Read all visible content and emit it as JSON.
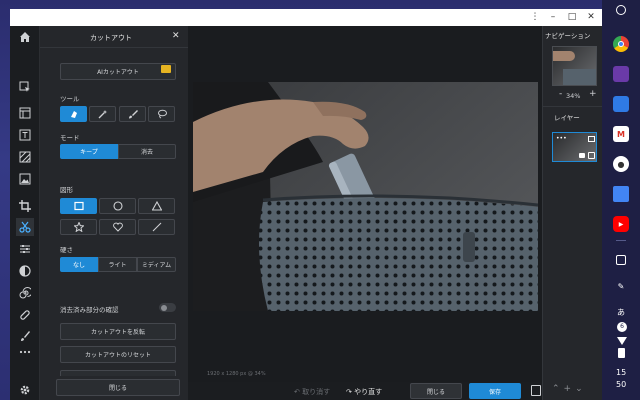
{
  "window": {
    "controls": [
      "⋮",
      "–",
      "□",
      "✕"
    ]
  },
  "left_rail": {
    "tools": [
      "home-icon",
      "pointer-icon",
      "layers-icon",
      "text-icon",
      "pattern-icon",
      "image-icon",
      "crop-icon",
      "cutout-icon",
      "adjust-icon",
      "filter-icon",
      "spiral-icon",
      "bandage-icon",
      "brush-icon",
      "more-icon"
    ],
    "settings_icon": "gear-icon"
  },
  "cutout_panel": {
    "title": "カットアウト",
    "close": "✕",
    "ai_cutout_label": "AIカットアウト",
    "tools_label": "ツール",
    "mode_label": "モード",
    "mode_keep": "キープ",
    "mode_erase": "消去",
    "shapes_label": "図形",
    "hardness_label": "硬さ",
    "hardness_none": "なし",
    "hardness_light": "ライト",
    "hardness_medium": "ミディアム",
    "confirm_erased_label": "消去済み部分の確認",
    "invert_label": "カットアウトを反転",
    "reset_label": "カットアウトのリセット",
    "close_button": "閉じる"
  },
  "canvas": {
    "status": "1920 x 1280 px @ 34%",
    "undo_label": "取り消す",
    "redo_label": "やり直す",
    "close_label": "閉じる",
    "save_label": "保存"
  },
  "right_panel": {
    "navigation_title": "ナビゲーション",
    "zoom_minus": "-",
    "zoom_value": "34%",
    "zoom_plus": "+",
    "layers_title": "レイヤー",
    "layer_more": "•••"
  },
  "shelf": {
    "time_hour": "15",
    "time_min": "50",
    "ime": "あ",
    "badge": "6"
  },
  "colors": {
    "accent": "#1f8ad6",
    "panel_bg": "#25272b"
  }
}
